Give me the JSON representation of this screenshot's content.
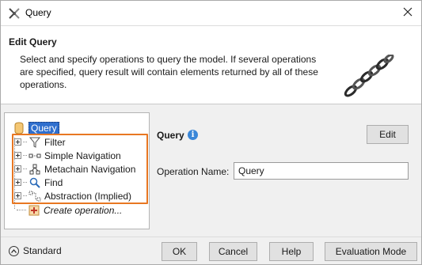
{
  "window": {
    "title": "Query",
    "close_icon": "close-icon",
    "app_icon": "magicdraw-app-icon"
  },
  "header": {
    "title": "Edit Query",
    "description": "Select and specify operations to query the model. If several operations are specified, query result will contain elements returned by all of these operations.",
    "graphic": "chain-link-graphic"
  },
  "tree": {
    "root": {
      "label": "Query",
      "icon": "query-icon",
      "selected": true
    },
    "items": [
      {
        "label": "Filter",
        "icon": "filter-icon",
        "expandable": true
      },
      {
        "label": "Simple Navigation",
        "icon": "simple-navigation-icon",
        "expandable": true
      },
      {
        "label": "Metachain Navigation",
        "icon": "metachain-navigation-icon",
        "expandable": true
      },
      {
        "label": "Find",
        "icon": "find-icon",
        "expandable": true
      },
      {
        "label": "Abstraction (Implied)",
        "icon": "abstraction-icon",
        "expandable": true
      }
    ],
    "create_item": {
      "label": "Create operation...",
      "icon": "add-icon"
    }
  },
  "detail": {
    "title": "Query",
    "edit_label": "Edit",
    "operation_name_label": "Operation Name:",
    "operation_name_value": "Query"
  },
  "footer": {
    "standard_label": "Standard",
    "ok_label": "OK",
    "cancel_label": "Cancel",
    "help_label": "Help",
    "evaluation_mode_label": "Evaluation Mode"
  },
  "colors": {
    "highlight": "#e87722",
    "selection": "#2f6fce",
    "info": "#3a87d8"
  }
}
